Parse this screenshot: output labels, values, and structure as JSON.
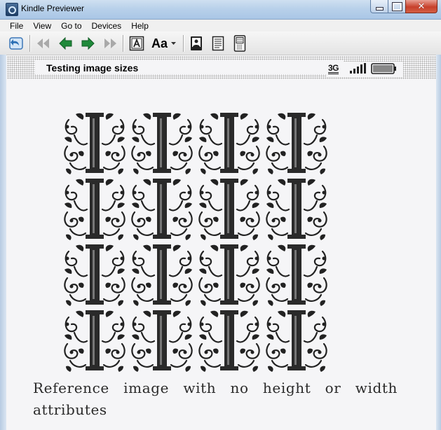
{
  "window": {
    "title": "Kindle Previewer",
    "close_glyph": "✕"
  },
  "menu": {
    "items": [
      "File",
      "View",
      "Go to",
      "Devices",
      "Help"
    ]
  },
  "toolbar": {
    "icons": [
      "back-to-home-icon",
      "first-page-icon",
      "previous-page-icon",
      "next-page-icon",
      "last-page-icon",
      "cover-page-icon",
      "font-size-icon",
      "orientation-icon",
      "page-icon",
      "kindle-device-icon"
    ],
    "font_size_label": "Aa"
  },
  "device_header": {
    "book_title": "Testing image sizes",
    "network": "3G"
  },
  "page": {
    "image_letter": "I",
    "caption": "Reference image with no height or width attributes"
  },
  "colors": {
    "accent_green": "#1f8a3a",
    "toolbar_blue": "#2b6fb5"
  }
}
